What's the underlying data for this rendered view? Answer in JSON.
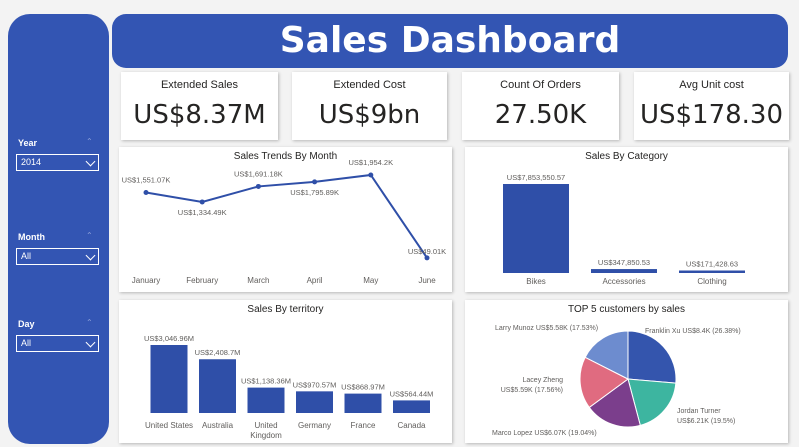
{
  "header": {
    "title": "Sales Dashboard"
  },
  "filters": [
    {
      "label": "Year",
      "value": "2014"
    },
    {
      "label": "Month",
      "value": "All"
    },
    {
      "label": "Day",
      "value": "All"
    }
  ],
  "kpis": [
    {
      "title": "Extended Sales",
      "value": "US$8.37M"
    },
    {
      "title": "Extended Cost",
      "value": "US$9bn"
    },
    {
      "title": "Count Of Orders",
      "value": "27.50K"
    },
    {
      "title": "Avg Unit cost",
      "value": "US$178.30"
    }
  ],
  "colors": {
    "accent": "#3355b3",
    "series": "#2f4fa8"
  },
  "chart_data": [
    {
      "type": "line",
      "title": "Sales Trends By Month",
      "categories": [
        "January",
        "February",
        "March",
        "April",
        "May",
        "June"
      ],
      "values": [
        1551.07,
        1334.49,
        1691.18,
        1795.89,
        1954.2,
        49.01
      ],
      "data_labels": [
        "US$1,551.07K",
        "US$1,334.49K",
        "US$1,691.18K",
        "US$1,795.89K",
        "US$1,9​54.2K",
        "US$49.01K"
      ],
      "grid": false
    },
    {
      "type": "bar",
      "title": "Sales By Category",
      "categories": [
        "Bikes",
        "Accessories",
        "Clothing"
      ],
      "values": [
        7853550.57,
        347850.53,
        171428.63
      ],
      "data_labels": [
        "US$7,853,550.57",
        "US$347,850.53",
        "US$171,428.63"
      ],
      "grid": false
    },
    {
      "type": "bar",
      "title": "Sales By territory",
      "categories": [
        "United States",
        "Australia",
        "United Kingdom",
        "Germany",
        "France",
        "Canada"
      ],
      "values": [
        3046.96,
        2408.7,
        1138.36,
        970.57,
        868.97,
        564.44
      ],
      "data_labels": [
        "US$3,046.96M",
        "US$2,408.7M",
        "US$1,138.36M",
        "US$970.57M",
        "US$868.97M",
        "US$564.44M"
      ],
      "grid": false
    },
    {
      "type": "pie",
      "title": "TOP 5 customers by sales",
      "labels": [
        "Franklin Xu",
        "Jordan Turner",
        "Marco Lopez",
        "Lacey Zheng",
        "Larry Munoz"
      ],
      "values": [
        8.4,
        6.21,
        6.07,
        5.59,
        5.58
      ],
      "data_labels": [
        "Franklin Xu US$8.4K (26.38%)",
        "Jordan Turner US$6.21K (19.5%)",
        "Marco Lopez US$6.07K (19.04%)",
        "Lacey Zheng US$5.59K (17.56%)",
        "Larry Munoz US$5.58K (17.53%)"
      ],
      "colors": [
        "#3455ad",
        "#3db5a0",
        "#7b3e8c",
        "#e06b80",
        "#6d8ccf"
      ]
    }
  ]
}
